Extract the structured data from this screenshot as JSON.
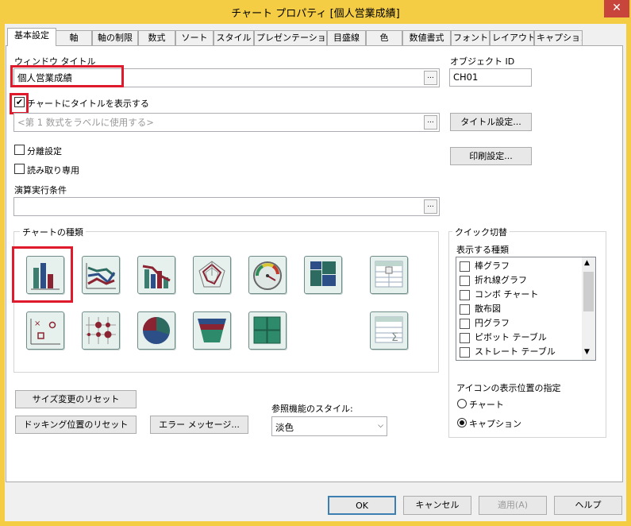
{
  "window": {
    "title": "チャート プロパティ [個人営業成績]",
    "close": "✕"
  },
  "tabs": [
    "基本設定",
    "軸",
    "軸の制限",
    "数式",
    "ソート",
    "スタイル",
    "プレゼンテーション",
    "目盛線",
    "色",
    "数値書式",
    "フォント",
    "レイアウト",
    "キャプション"
  ],
  "general": {
    "window_title_label": "ウィンドウ タイトル",
    "window_title_value": "個人営業成績",
    "object_id_label": "オブジェクト ID",
    "object_id_value": "CH01",
    "show_title_label": "チャートにタイトルを表示する",
    "show_title_checked": true,
    "title_placeholder": "<第 1 数式をラベルに使用する>",
    "title_settings_button": "タイトル設定...",
    "print_settings_button": "印刷設定...",
    "detach_label": "分離設定",
    "readonly_label": "読み取り専用",
    "calc_condition_label": "演算実行条件",
    "ellipsis": "..."
  },
  "chart_types": {
    "label": "チャートの種類",
    "icons": [
      "bar-chart-icon",
      "line-chart-icon",
      "combo-chart-icon",
      "radar-chart-icon",
      "gauge-chart-icon",
      "mekko-chart-icon",
      "pivot-table-icon",
      "scatter-chart-icon",
      "grid-chart-icon",
      "pie-chart-icon",
      "funnel-chart-icon",
      "block-chart-icon",
      "straight-table-icon"
    ],
    "selected": "bar-chart-icon"
  },
  "quick_switch": {
    "label": "クイック切替",
    "types_label": "表示する種類",
    "items": [
      "棒グラフ",
      "折れ線グラフ",
      "コンボ チャート",
      "散布図",
      "円グラフ",
      "ピボット テーブル",
      "ストレート テーブル"
    ],
    "icon_position_label": "アイコンの表示位置の指定",
    "radio_options": [
      "チャート",
      "キャプション"
    ],
    "radio_selected": "キャプション"
  },
  "buttons": {
    "reset_size": "サイズ変更のリセット",
    "reset_docking": "ドッキング位置のリセット",
    "error_messages": "エラー メッセージ...",
    "ok": "OK",
    "cancel": "キャンセル",
    "apply": "適用(A)",
    "help": "ヘルプ"
  },
  "reference_style": {
    "label": "参照機能のスタイル:",
    "value": "淡色"
  },
  "colors": {
    "titlebar": "#f4cd45",
    "highlight": "#e01a2d",
    "close": "#c7453b"
  }
}
